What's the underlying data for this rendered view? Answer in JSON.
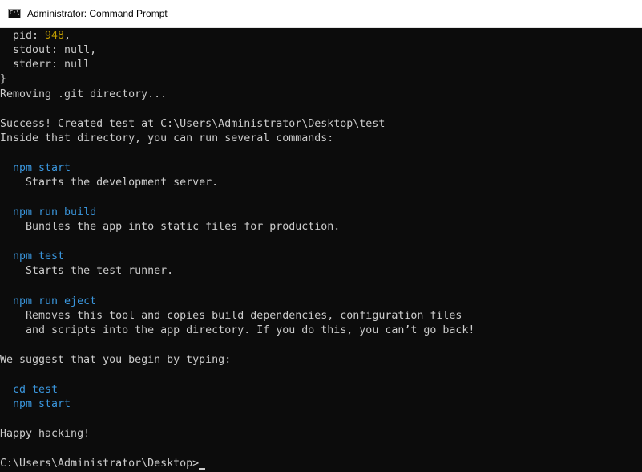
{
  "window": {
    "title": "Administrator: Command Prompt",
    "icon": "cmd-icon",
    "icon_text": "C:\\."
  },
  "console": {
    "pid_key": "  pid: ",
    "pid_value": "948",
    "pid_suffix": ",",
    "stdout_line": "  stdout: null,",
    "stderr_line": "  stderr: null",
    "close_brace": "}",
    "removing_git": "Removing .git directory...",
    "success_line": "Success! Created test at C:\\Users\\Administrator\\Desktop\\test",
    "inside_line": "Inside that directory, you can run several commands:",
    "commands": [
      {
        "cmd": "  npm start",
        "desc": "    Starts the development server."
      },
      {
        "cmd": "  npm run build",
        "desc": "    Bundles the app into static files for production."
      },
      {
        "cmd": "  npm test",
        "desc": "    Starts the test runner."
      },
      {
        "cmd": "  npm run eject",
        "desc": "    Removes this tool and copies build dependencies, configuration files",
        "desc2": "    and scripts into the app directory. If you do this, you can’t go back!"
      }
    ],
    "suggest_line": "We suggest that you begin by typing:",
    "suggest_cmds": [
      "  cd test",
      "  npm start"
    ],
    "happy_line": "Happy hacking!",
    "prompt": "C:\\Users\\Administrator\\Desktop>"
  },
  "colors": {
    "background": "#0c0c0c",
    "text": "#cccccc",
    "command": "#3a96dd",
    "number": "#c19c00"
  }
}
